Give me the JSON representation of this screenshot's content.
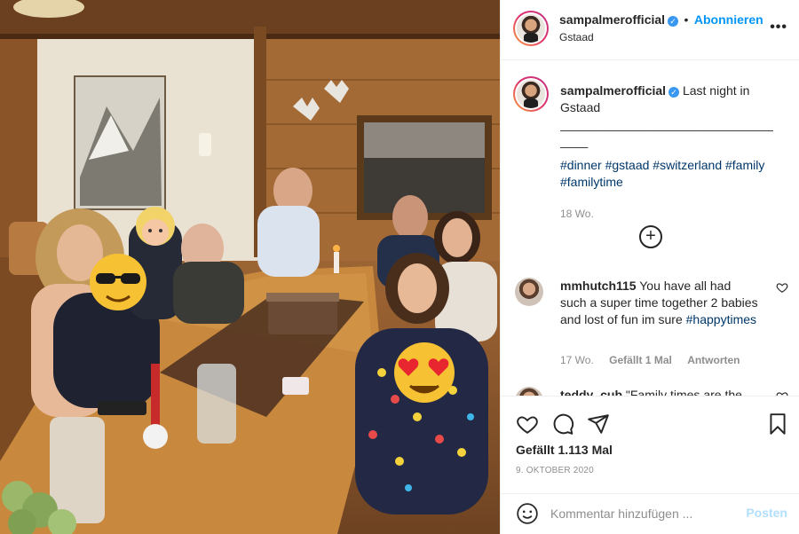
{
  "post": {
    "username": "sampalmerofficial",
    "verified_mark": "✓",
    "separator": "•",
    "follow_label": "Abonnieren",
    "location": "Gstaad",
    "more_label": "•••"
  },
  "caption": {
    "username": "sampalmerofficial",
    "text": "Last night in Gstaad",
    "rule": "________________________________",
    "rule2": "____",
    "hashtags": "#dinner #gstaad #switzerland #family #familytime",
    "age": "18 Wo."
  },
  "load_more_label": "+",
  "comments": [
    {
      "username": "mmhutch115",
      "text": "You have all had such a super time together 2 babies and lost of fun im sure",
      "hashtag": "#happytimes",
      "age": "17 Wo.",
      "likes": "Gefällt 1 Mal",
      "reply": "Antworten"
    },
    {
      "username": "teddy_cub",
      "text": "\"Family times are the"
    }
  ],
  "actions": {
    "likes": "Gefällt 1.113 Mal",
    "date": "9. OKTOBER 2020",
    "icons": [
      "heart-icon",
      "comment-icon",
      "share-icon",
      "bookmark-icon"
    ]
  },
  "add_comment": {
    "placeholder": "Kommentar hinzufügen ...",
    "post_label": "Posten"
  },
  "colors": {
    "accent": "#0095f6",
    "hashtag": "#00376b",
    "muted": "#8e8e8e",
    "post_disabled": "#b2dffc"
  }
}
